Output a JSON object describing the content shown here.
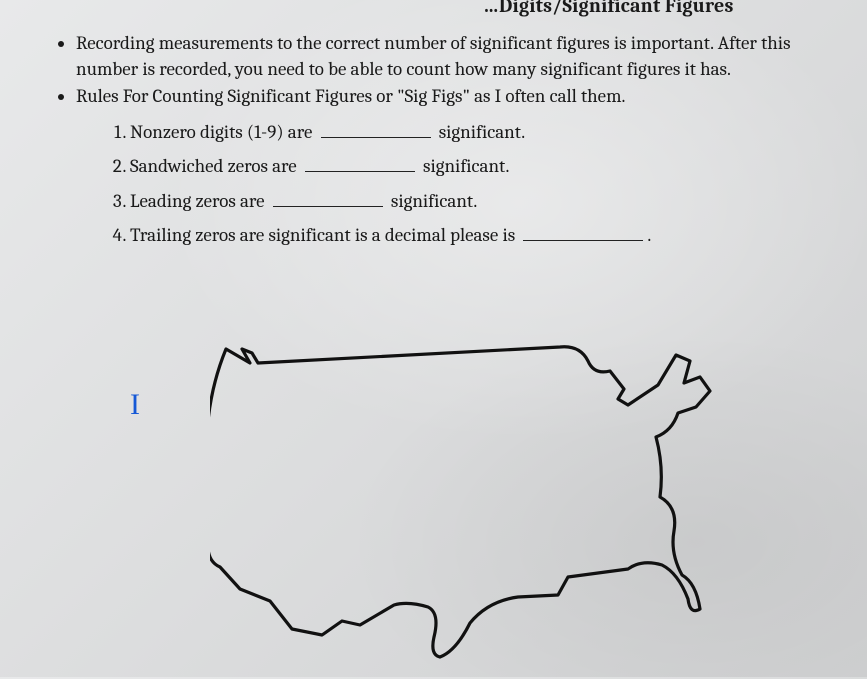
{
  "title_fragment": "…Digits/Significant Figures",
  "bullets": [
    "Recording measurements to the correct number of significant figures is important. After this number is recorded, you need to be able to count how many significant figures it has.",
    "Rules For Counting Significant Figures or \"Sig Figs\" as I often call them."
  ],
  "rules": [
    {
      "pre": "Nonzero digits (1-9) are ",
      "post": " significant."
    },
    {
      "pre": "Sandwiched zeros are ",
      "post": " significant."
    },
    {
      "pre": "Leading zeros are ",
      "post": " significant."
    },
    {
      "pre": "Trailing zeros are significant is a decimal please is ",
      "post": "."
    }
  ],
  "cursor_glyph": "I",
  "map_alt": "outline-us-map"
}
